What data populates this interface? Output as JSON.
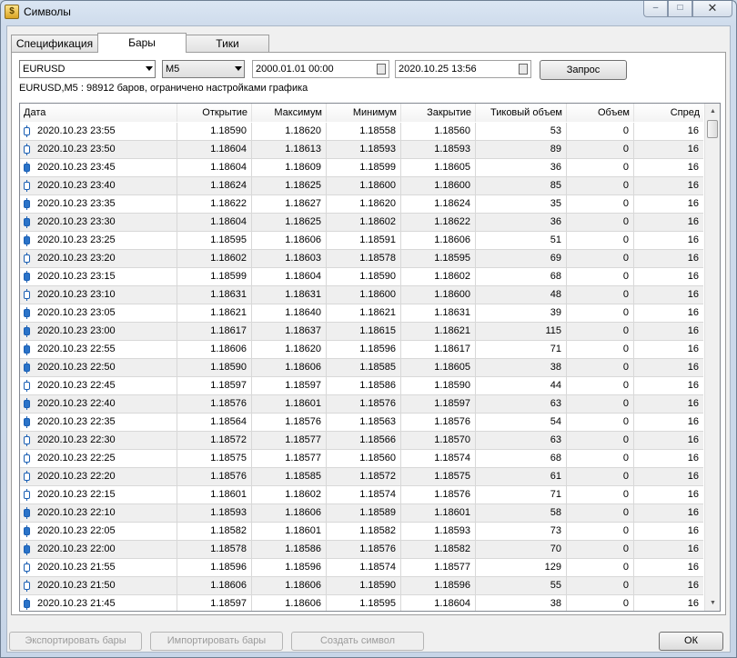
{
  "window": {
    "title": "Символы",
    "icon": "symbols-dollar-icon",
    "caption_minimize": "–",
    "caption_maximize": "□",
    "caption_close": "✕"
  },
  "tabs": [
    {
      "label": "Спецификация",
      "active": false
    },
    {
      "label": "Бары",
      "active": true
    },
    {
      "label": "Тики",
      "active": false
    }
  ],
  "toolbar": {
    "symbol": "EURUSD",
    "timeframe": "M5",
    "date_from": "2000.01.01 00:00",
    "date_to": "2020.10.25 13:56",
    "request_label": "Запрос"
  },
  "info_line": "EURUSD,M5 : 98912 баров, ограничено настройками графика",
  "table": {
    "columns": [
      "Дата",
      "Открытие",
      "Максимум",
      "Минимум",
      "Закрытие",
      "Тиковый объем",
      "Объем",
      "Спред"
    ],
    "rows": [
      [
        "2020.10.23 23:55",
        "1.18590",
        "1.18620",
        "1.18558",
        "1.18560",
        "53",
        "0",
        "16"
      ],
      [
        "2020.10.23 23:50",
        "1.18604",
        "1.18613",
        "1.18593",
        "1.18593",
        "89",
        "0",
        "16"
      ],
      [
        "2020.10.23 23:45",
        "1.18604",
        "1.18609",
        "1.18599",
        "1.18605",
        "36",
        "0",
        "16"
      ],
      [
        "2020.10.23 23:40",
        "1.18624",
        "1.18625",
        "1.18600",
        "1.18600",
        "85",
        "0",
        "16"
      ],
      [
        "2020.10.23 23:35",
        "1.18622",
        "1.18627",
        "1.18620",
        "1.18624",
        "35",
        "0",
        "16"
      ],
      [
        "2020.10.23 23:30",
        "1.18604",
        "1.18625",
        "1.18602",
        "1.18622",
        "36",
        "0",
        "16"
      ],
      [
        "2020.10.23 23:25",
        "1.18595",
        "1.18606",
        "1.18591",
        "1.18606",
        "51",
        "0",
        "16"
      ],
      [
        "2020.10.23 23:20",
        "1.18602",
        "1.18603",
        "1.18578",
        "1.18595",
        "69",
        "0",
        "16"
      ],
      [
        "2020.10.23 23:15",
        "1.18599",
        "1.18604",
        "1.18590",
        "1.18602",
        "68",
        "0",
        "16"
      ],
      [
        "2020.10.23 23:10",
        "1.18631",
        "1.18631",
        "1.18600",
        "1.18600",
        "48",
        "0",
        "16"
      ],
      [
        "2020.10.23 23:05",
        "1.18621",
        "1.18640",
        "1.18621",
        "1.18631",
        "39",
        "0",
        "16"
      ],
      [
        "2020.10.23 23:00",
        "1.18617",
        "1.18637",
        "1.18615",
        "1.18621",
        "115",
        "0",
        "16"
      ],
      [
        "2020.10.23 22:55",
        "1.18606",
        "1.18620",
        "1.18596",
        "1.18617",
        "71",
        "0",
        "16"
      ],
      [
        "2020.10.23 22:50",
        "1.18590",
        "1.18606",
        "1.18585",
        "1.18605",
        "38",
        "0",
        "16"
      ],
      [
        "2020.10.23 22:45",
        "1.18597",
        "1.18597",
        "1.18586",
        "1.18590",
        "44",
        "0",
        "16"
      ],
      [
        "2020.10.23 22:40",
        "1.18576",
        "1.18601",
        "1.18576",
        "1.18597",
        "63",
        "0",
        "16"
      ],
      [
        "2020.10.23 22:35",
        "1.18564",
        "1.18576",
        "1.18563",
        "1.18576",
        "54",
        "0",
        "16"
      ],
      [
        "2020.10.23 22:30",
        "1.18572",
        "1.18577",
        "1.18566",
        "1.18570",
        "63",
        "0",
        "16"
      ],
      [
        "2020.10.23 22:25",
        "1.18575",
        "1.18577",
        "1.18560",
        "1.18574",
        "68",
        "0",
        "16"
      ],
      [
        "2020.10.23 22:20",
        "1.18576",
        "1.18585",
        "1.18572",
        "1.18575",
        "61",
        "0",
        "16"
      ],
      [
        "2020.10.23 22:15",
        "1.18601",
        "1.18602",
        "1.18574",
        "1.18576",
        "71",
        "0",
        "16"
      ],
      [
        "2020.10.23 22:10",
        "1.18593",
        "1.18606",
        "1.18589",
        "1.18601",
        "58",
        "0",
        "16"
      ],
      [
        "2020.10.23 22:05",
        "1.18582",
        "1.18601",
        "1.18582",
        "1.18593",
        "73",
        "0",
        "16"
      ],
      [
        "2020.10.23 22:00",
        "1.18578",
        "1.18586",
        "1.18576",
        "1.18582",
        "70",
        "0",
        "16"
      ],
      [
        "2020.10.23 21:55",
        "1.18596",
        "1.18596",
        "1.18574",
        "1.18577",
        "129",
        "0",
        "16"
      ],
      [
        "2020.10.23 21:50",
        "1.18606",
        "1.18606",
        "1.18590",
        "1.18596",
        "55",
        "0",
        "16"
      ],
      [
        "2020.10.23 21:45",
        "1.18597",
        "1.18606",
        "1.18595",
        "1.18604",
        "38",
        "0",
        "16"
      ]
    ]
  },
  "footer": {
    "export_label": "Экспортировать бары",
    "import_label": "Импортировать бары",
    "create_label": "Создать символ",
    "ok_label": "ОК"
  },
  "colors": {
    "candle": "#1a5fb4",
    "row_alt": "#efefef"
  }
}
